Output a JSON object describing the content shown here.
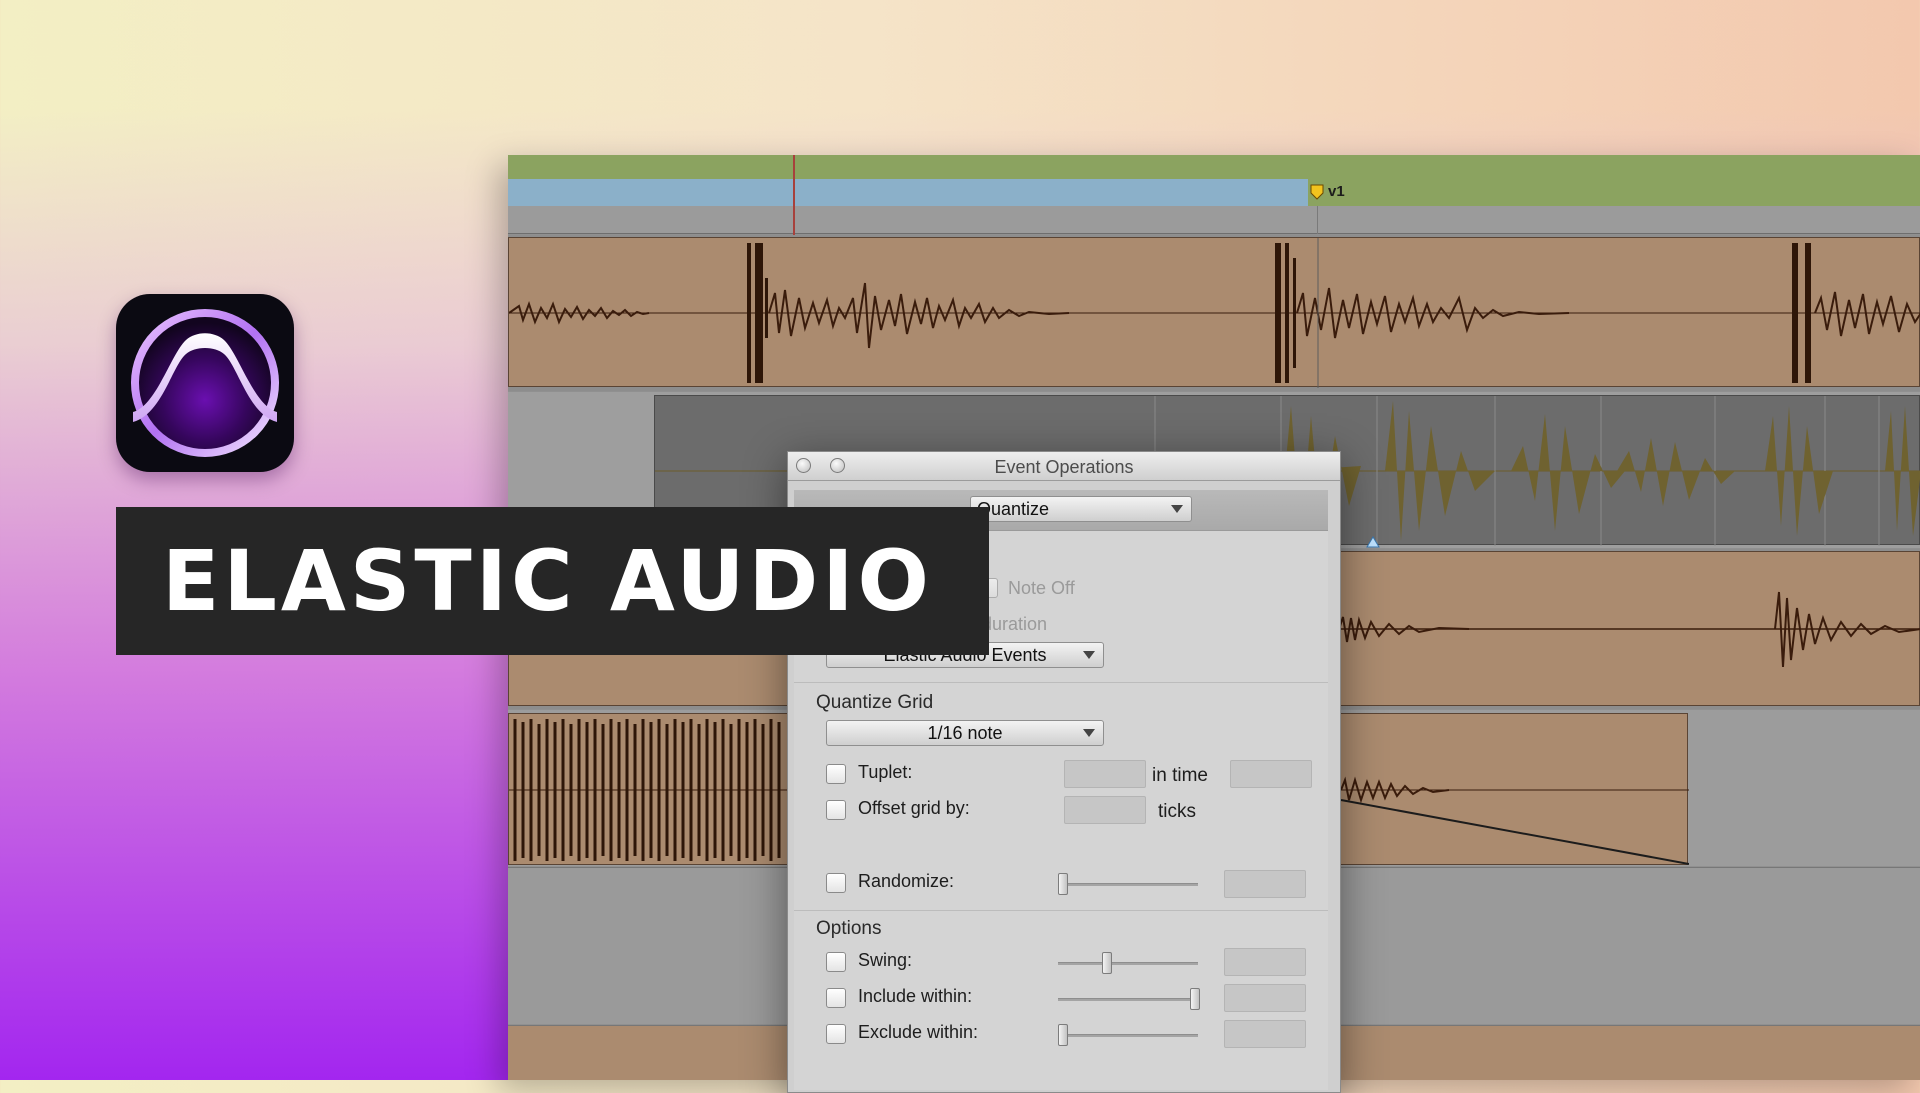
{
  "banner": {
    "title": "ELASTIC AUDIO"
  },
  "logo": {
    "icon": "pro-tools-logo-icon"
  },
  "timeline": {
    "marker_label": "v1"
  },
  "dialog": {
    "title": "Event Operations",
    "operation_select": "Quantize",
    "what_to_quantize": {
      "note_off_label": "Note Off",
      "duration_label": "duration",
      "select_value": "Elastic Audio Events"
    },
    "quantize_grid": {
      "section_label": "Quantize Grid",
      "grid_value": "1/16 note",
      "tuplet_label": "Tuplet:",
      "in_time_label": "in time",
      "offset_label": "Offset grid by:",
      "ticks_label": "ticks",
      "randomize_label": "Randomize:"
    },
    "options": {
      "section_label": "Options",
      "swing_label": "Swing:",
      "include_label": "Include within:",
      "exclude_label": "Exclude within:"
    }
  },
  "colors": {
    "clip": "#ab8b6f",
    "waveform": "#3a1c0c",
    "ruler_green": "#8ba360",
    "ruler_blue": "#8bb0c9",
    "banner_bg": "#262626"
  }
}
